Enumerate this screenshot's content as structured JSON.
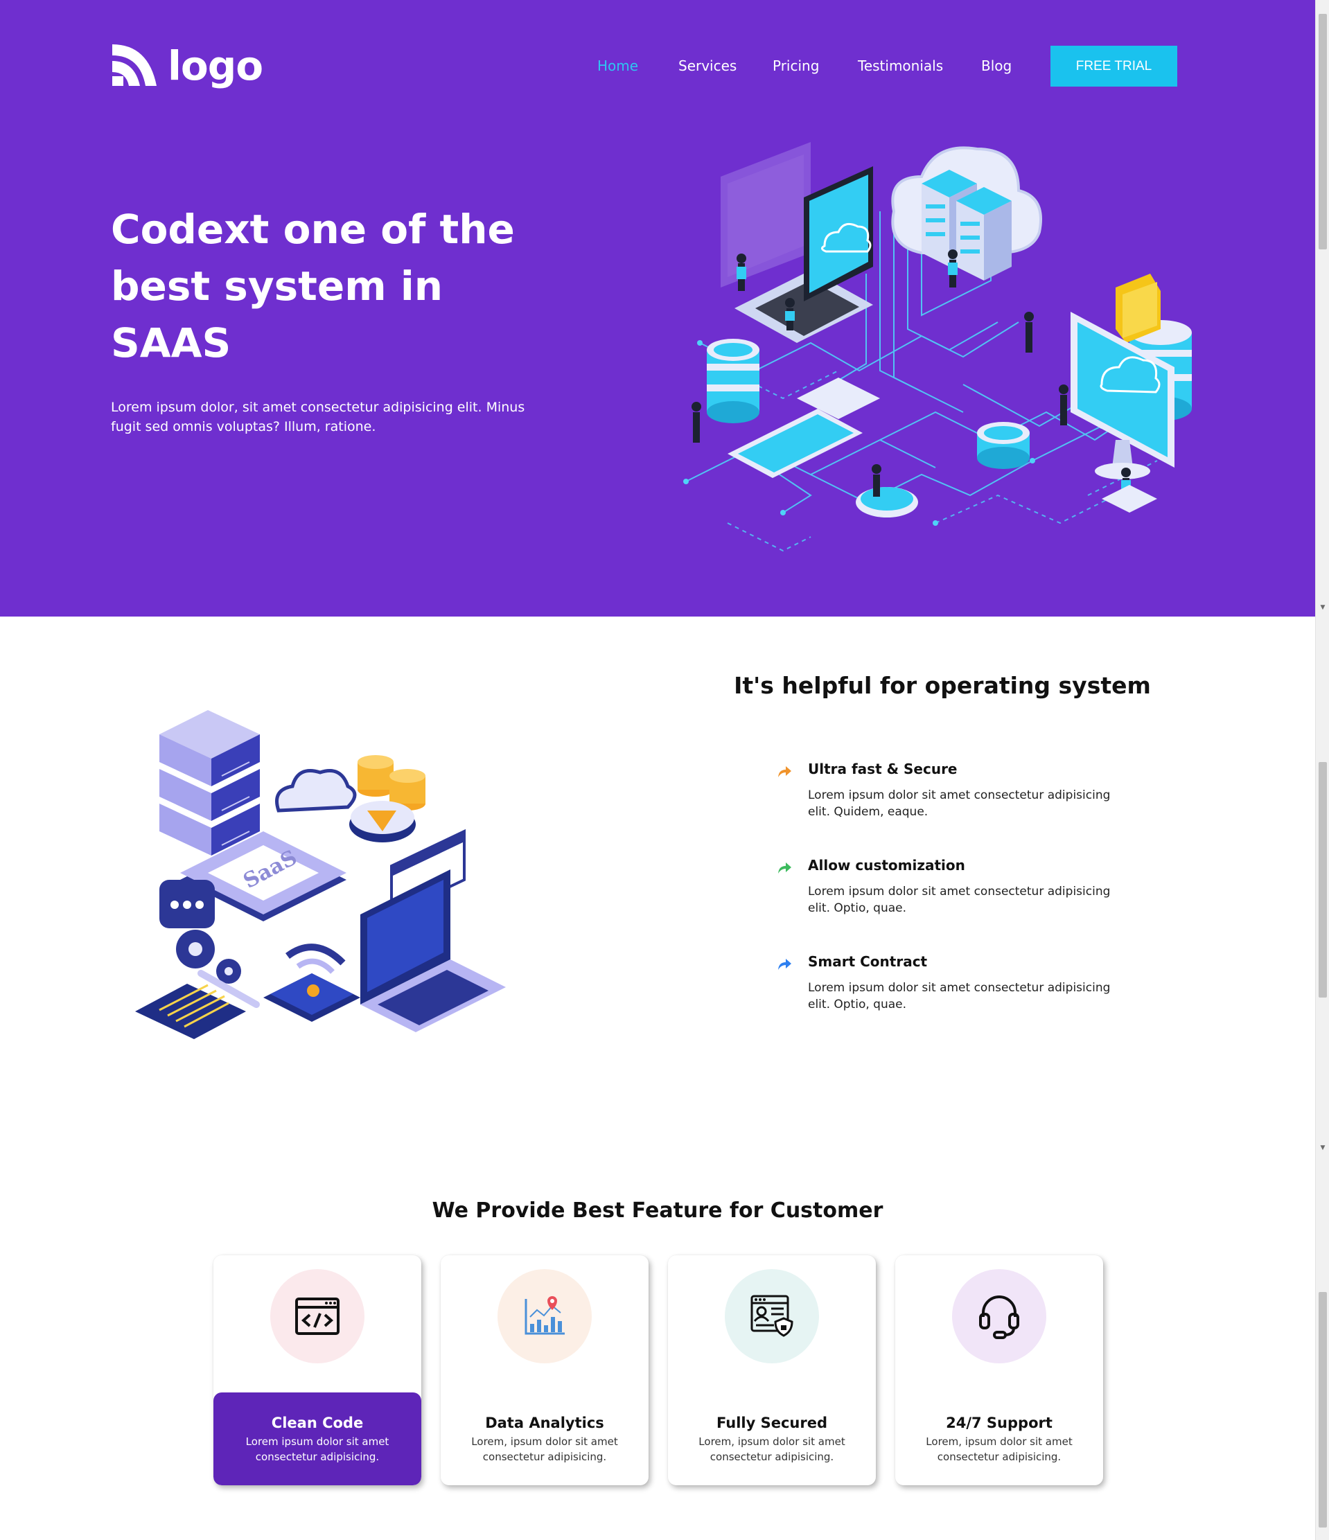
{
  "logo": {
    "text": "logo"
  },
  "nav": {
    "items": [
      {
        "label": "Home",
        "active": true
      },
      {
        "label": "Services"
      },
      {
        "label": "Pricing"
      },
      {
        "label": "Testimonials"
      },
      {
        "label": "Blog"
      }
    ],
    "cta_label": "FREE TRIAL"
  },
  "hero": {
    "title_lines": [
      "Codext one of the",
      "best system in",
      "SAAS"
    ],
    "subtitle_lines": [
      "Lorem ipsum dolor, sit amet consectetur adipisicing elit. Minus",
      "fugit sed omnis voluptas? Illum, ratione."
    ],
    "background_color": "#6f2fcf",
    "accent_color": "#1ac2ee"
  },
  "helpful": {
    "title": "It's helpful for operating system",
    "illustration_label": "SaaS",
    "items": [
      {
        "title": "Ultra fast & Secure",
        "text_lines": [
          "Lorem ipsum dolor sit amet consectetur adipisicing",
          "elit. Quidem, eaque."
        ],
        "arrow_color": "#f0932b",
        "icon": "share-arrow-icon"
      },
      {
        "title": "Allow customization",
        "text_lines": [
          "Lorem ipsum dolor sit amet consectetur adipisicing",
          "elit. Optio, quae."
        ],
        "arrow_color": "#3dbb5e",
        "icon": "share-arrow-icon"
      },
      {
        "title": "Smart Contract",
        "text_lines": [
          "Lorem ipsum dolor sit amet consectetur adipisicing",
          "elit. Optio, quae."
        ],
        "arrow_color": "#2d7ff0",
        "icon": "share-arrow-icon"
      }
    ]
  },
  "features": {
    "title": "We Provide Best Feature for Customer",
    "cards": [
      {
        "title": "Clean Code",
        "text_lines": [
          "Lorem ipsum dolor sit amet",
          "consectetur adipisicing."
        ],
        "icon": "code-window-icon",
        "circle_color": "#fbe9ec",
        "active": true
      },
      {
        "title": "Data Analytics",
        "text_lines": [
          "Lorem, ipsum dolor sit amet",
          "consectetur adipisicing."
        ],
        "icon": "analytics-chart-icon",
        "circle_color": "#fcefe6",
        "active": false
      },
      {
        "title": "Fully Secured",
        "text_lines": [
          "Lorem, ipsum dolor sit amet",
          "consectetur adipisicing."
        ],
        "icon": "secure-document-icon",
        "circle_color": "#e6f4f3",
        "active": false
      },
      {
        "title": "24/7 Support",
        "text_lines": [
          "Lorem, ipsum dolor sit amet",
          "consectetur adipisicing."
        ],
        "icon": "headset-icon",
        "circle_color": "#f1e5f8",
        "active": false
      }
    ],
    "active_color": "#5e25b8"
  }
}
